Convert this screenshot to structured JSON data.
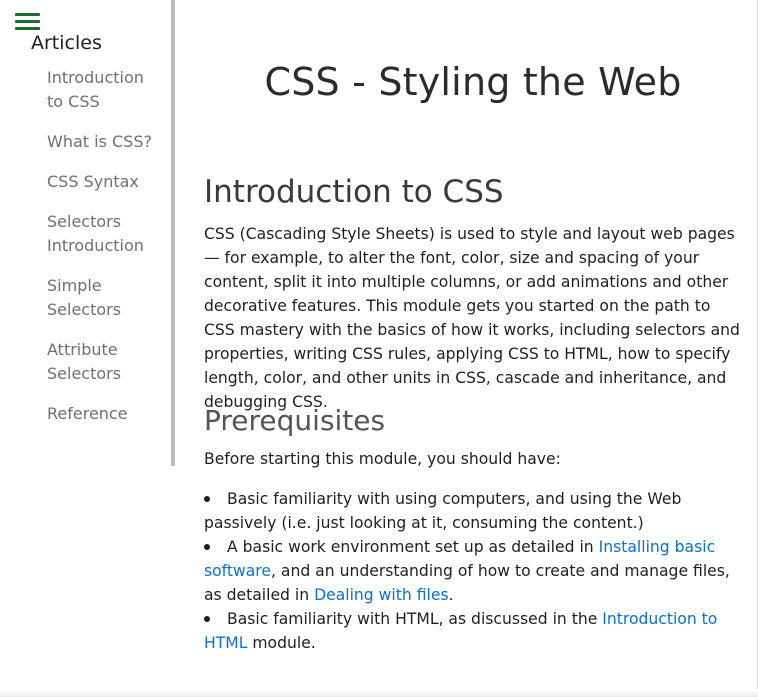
{
  "sidebar": {
    "menu_icon": "hamburger-menu-icon",
    "heading": "Articles",
    "items": [
      {
        "label": "Introduction to CSS"
      },
      {
        "label": "What is CSS?"
      },
      {
        "label": "CSS Syntax"
      },
      {
        "label": "Selectors Introduction"
      },
      {
        "label": "Simple Selectors"
      },
      {
        "label": "Attribute Selectors"
      },
      {
        "label": "Reference"
      }
    ]
  },
  "main": {
    "title": "CSS - Styling the Web",
    "intro_heading": "Introduction to CSS",
    "intro_text": "CSS (Cascading Style Sheets) is used to style and layout web pages — for example, to alter the font, color, size and spacing of your content, split it into multiple columns, or add animations and other decorative features. This module gets you started on the path to CSS mastery with the basics of how it works, including selectors and properties, writing CSS rules, applying CSS to HTML, how to specify length, color, and other units in CSS, cascade and inheritance, and debugging CSS.",
    "prereq_heading": "Prerequisites",
    "prereq_lead": "Before starting this module, you should have:",
    "prereq_items": {
      "item1": {
        "text": "Basic familiarity with using computers, and using the Web passively (i.e. just looking at it, consuming the content.)"
      },
      "item2": {
        "text_before": "A basic work environment set up as detailed in ",
        "link1": "Installing basic software",
        "text_middle": ", and an understanding of how to create and manage files, as detailed in ",
        "link2": "Dealing with files",
        "text_after": "."
      },
      "item3": {
        "text_before": "Basic familiarity with HTML, as discussed in the ",
        "link": "Introduction to HTML",
        "text_after": " module."
      }
    }
  },
  "colors": {
    "menu_icon": "#1e6b2e",
    "link": "#0b6fd6",
    "sidebar_text": "#707070",
    "sidebar_rule": "#bdbdbd"
  }
}
